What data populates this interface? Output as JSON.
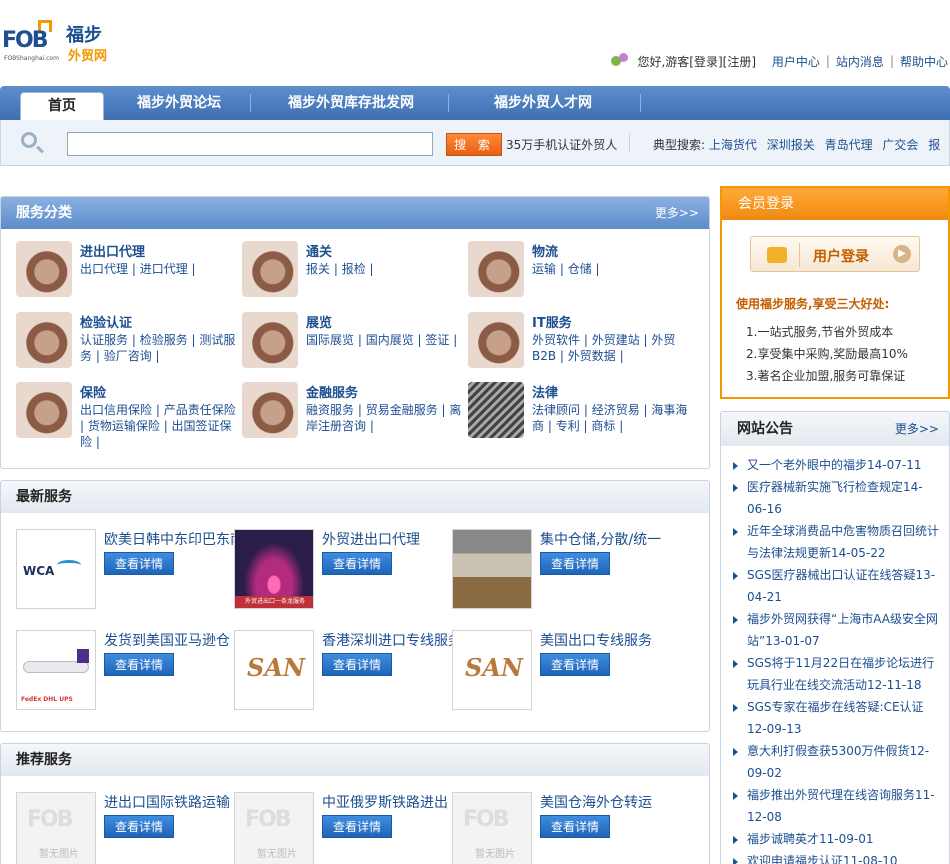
{
  "logo": {
    "fob": "FOB",
    "sub": "FOBShanghai.com",
    "cn1": "福步",
    "cn2": "外贸网"
  },
  "userbar": {
    "greeting": "您好,游客",
    "login": "[登录]",
    "register": "[注册]",
    "user_center": "用户中心",
    "site_messages": "站内消息",
    "help_center": "帮助中心"
  },
  "nav": {
    "tabs": [
      "首页",
      "福步外贸论坛",
      "福步外贸库存批发网",
      "福步外贸人才网"
    ]
  },
  "search": {
    "button": "搜 索",
    "promo": "35万手机认证外贸人",
    "hot_label": "典型搜索:",
    "hot": [
      "上海货代",
      "深圳报关",
      "青岛代理",
      "广交会",
      "报"
    ]
  },
  "service_categories": {
    "title": "服务分类",
    "more": "更多>>",
    "items": [
      {
        "title": "进出口代理",
        "links": [
          "出口代理",
          "进口代理"
        ]
      },
      {
        "title": "通关",
        "links": [
          "报关",
          "报检"
        ]
      },
      {
        "title": "物流",
        "links": [
          "运输",
          "仓储"
        ]
      },
      {
        "title": "检验认证",
        "links": [
          "认证服务",
          "检验服务",
          "测试服务",
          "验厂咨询"
        ]
      },
      {
        "title": "展览",
        "links": [
          "国际展览",
          "国内展览",
          "签证"
        ]
      },
      {
        "title": "IT服务",
        "links": [
          "外贸软件",
          "外贸建站",
          "外贸B2B",
          "外贸数据"
        ]
      },
      {
        "title": "保险",
        "links": [
          "出口信用保险",
          "产品责任保险",
          "货物运输保险",
          "出国签证保险"
        ]
      },
      {
        "title": "金融服务",
        "links": [
          "融资服务",
          "贸易金融服务",
          "离岸注册咨询"
        ]
      },
      {
        "title": "法律",
        "links": [
          "法律顾问",
          "经济贸易",
          "海事海商",
          "专利",
          "商标"
        ]
      }
    ]
  },
  "latest_services": {
    "title": "最新服务",
    "detail_label": "查看详情",
    "items": [
      {
        "name": "欧美日韩中东印巴东南亚",
        "image_text": "WCA"
      },
      {
        "name": "外贸进出口代理",
        "image_text": "外贸进出口一条龙服务"
      },
      {
        "name": "集中仓储,分散/统一",
        "image_text": ""
      },
      {
        "name": "发货到美国亚马逊仓",
        "image_text": "FedEx DHL UPS"
      },
      {
        "name": "香港深圳进口专线服务",
        "image_text": "SAN"
      },
      {
        "name": "美国出口专线服务",
        "image_text": "SAN"
      }
    ]
  },
  "recommended_services": {
    "title": "推荐服务",
    "detail_label": "查看详情",
    "no_image": "暂无图片",
    "items": [
      {
        "name": "进出口国际铁路运输"
      },
      {
        "name": "中亚俄罗斯铁路进出"
      },
      {
        "name": "美国仓海外仓转运"
      }
    ]
  },
  "member_login": {
    "title": "会员登录",
    "button": "用户登录",
    "slogan": "使用福步服务,享受三大好处:",
    "benefits": [
      "1.一站式服务,节省外贸成本",
      "2.享受集中采购,奖励最高10%",
      "3.著名企业加盟,服务可靠保证"
    ]
  },
  "announcements": {
    "title": "网站公告",
    "more": "更多>>",
    "items": [
      "又一个老外眼中的福步14-07-11",
      "医疗器械新实施飞行检查规定14-06-16",
      "近年全球消费品中危害物质召回统计与法律法规更新14-05-22",
      "SGS医疗器械出口认证在线答疑13-04-21",
      "福步外贸网获得“上海市AA级安全网站”13-01-07",
      "SGS将于11月22日在福步论坛进行玩具行业在线交流活动12-11-18",
      "SGS专家在福步在线答疑:CE认证12-09-13",
      "意大利打假查获5300万件假货12-09-02",
      "福步推出外贸代理在线咨询服务11-12-08",
      "福步诚聘英才11-09-01",
      "欢迎申请福步认证11-08-10"
    ]
  },
  "colors": {
    "brand_blue": "#1d4f91",
    "brand_orange": "#f39800"
  }
}
